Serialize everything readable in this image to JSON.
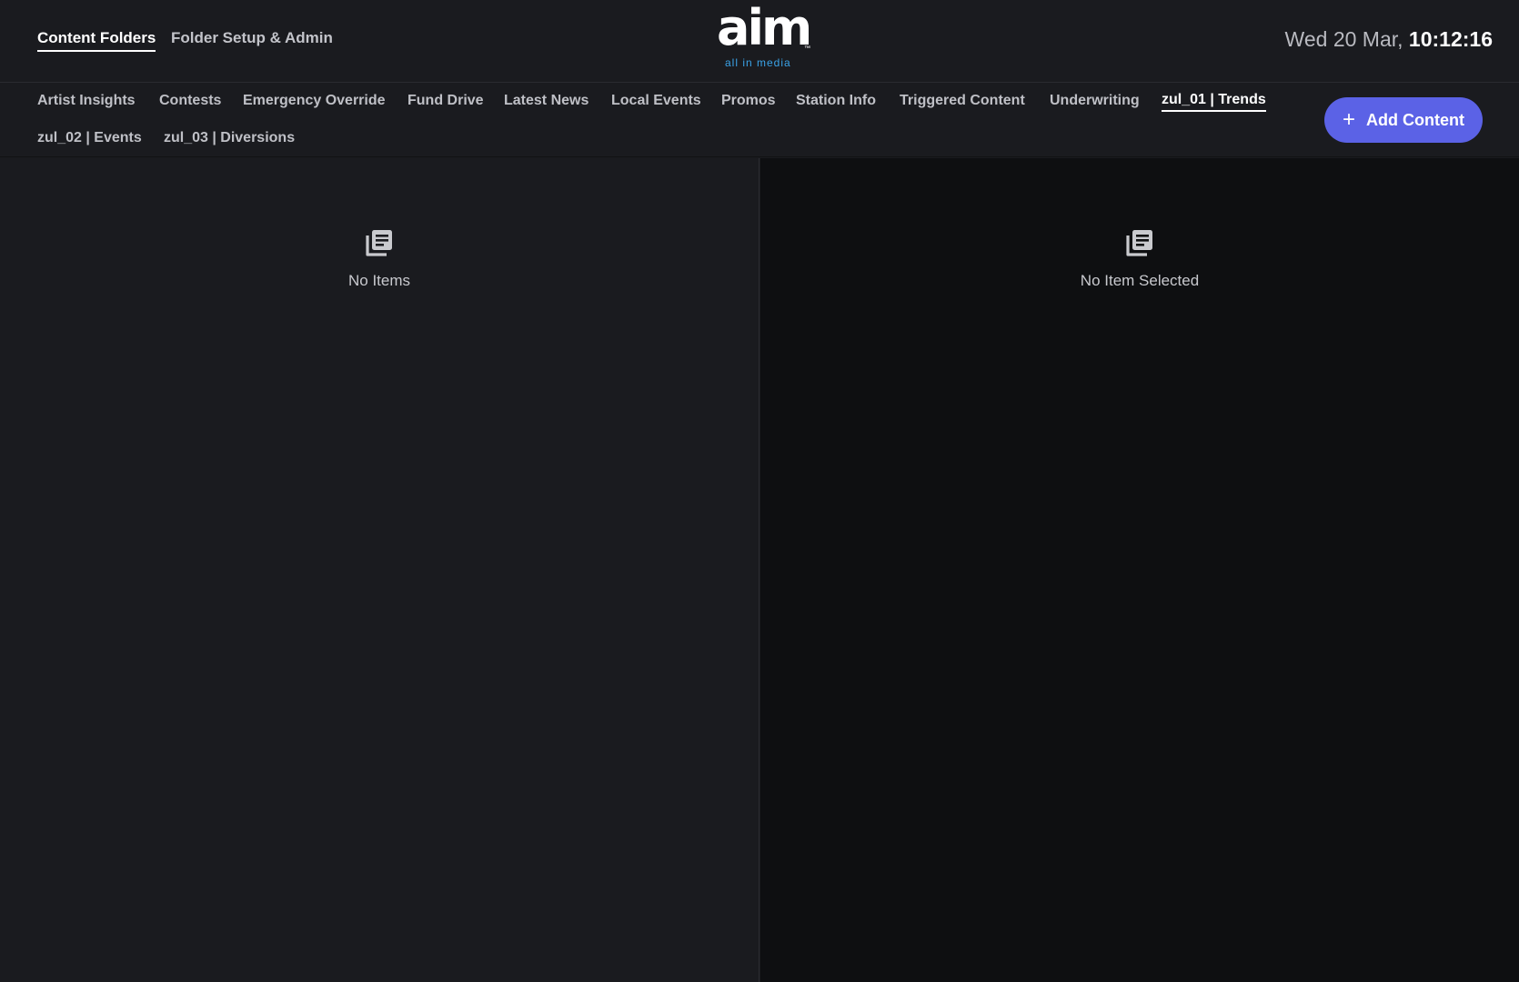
{
  "top_nav": {
    "tabs": [
      {
        "label": "Content Folders",
        "active": true
      },
      {
        "label": "Folder Setup & Admin",
        "active": false
      }
    ]
  },
  "logo": {
    "word": "aim",
    "tm": "™",
    "subtitle": "all in media"
  },
  "clock": {
    "date": "Wed 20 Mar,",
    "time": "10:12:16"
  },
  "folder_tabs": [
    {
      "label": "Artist Insights",
      "active": false
    },
    {
      "label": "Contests",
      "active": false
    },
    {
      "label": "Emergency Override",
      "active": false
    },
    {
      "label": "Fund Drive",
      "active": false
    },
    {
      "label": "Latest News",
      "active": false
    },
    {
      "label": "Local Events",
      "active": false
    },
    {
      "label": "Promos",
      "active": false
    },
    {
      "label": "Station Info",
      "active": false
    },
    {
      "label": "Triggered Content",
      "active": false
    },
    {
      "label": "Underwriting",
      "active": false
    },
    {
      "label": "zul_01 | Trends",
      "active": true
    },
    {
      "label": "zul_02 | Events",
      "active": false
    },
    {
      "label": "zul_03 | Diversions",
      "active": false
    }
  ],
  "add_button": {
    "icon": "plus-icon",
    "label": "Add Content"
  },
  "list_panel": {
    "icon": "document-list-icon",
    "empty_text": "No Items"
  },
  "detail_panel": {
    "icon": "document-list-icon",
    "empty_text": "No Item Selected"
  },
  "colors": {
    "accent": "#5b62e6",
    "logo_subtitle": "#3aa3e8",
    "background": "#1a1b1f",
    "detail_background": "#0e0f11"
  }
}
